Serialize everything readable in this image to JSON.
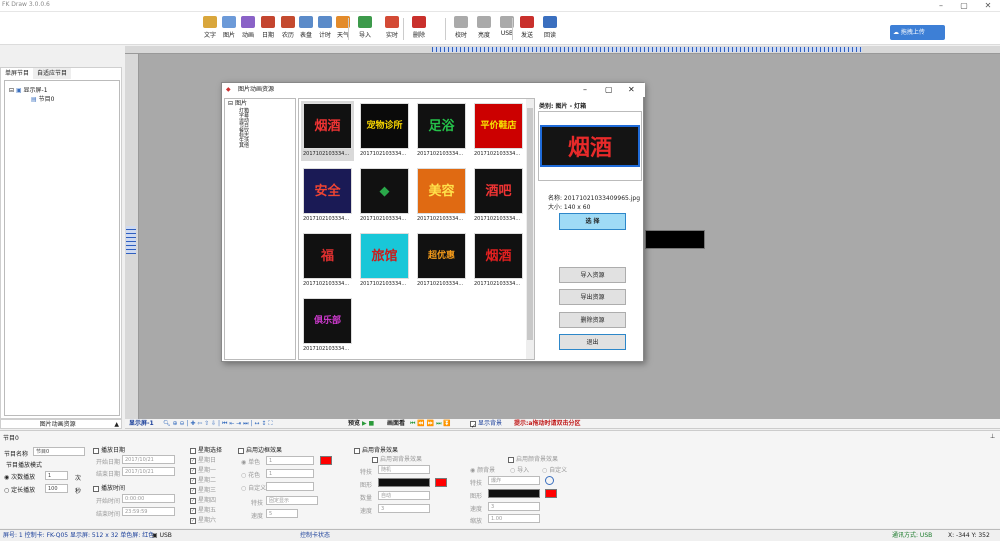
{
  "window": {
    "title": "FK Draw 3.0.0.6"
  },
  "toolbar": {
    "items": [
      {
        "label": "文字",
        "color": "#d9a63b"
      },
      {
        "label": "图片",
        "color": "#6c9ad8"
      },
      {
        "label": "动画",
        "color": "#8a62c7"
      },
      {
        "label": "日期",
        "color": "#c4452f"
      },
      {
        "label": "农历",
        "color": "#c44a2f"
      },
      {
        "label": "表盘",
        "color": "#5b8bc9"
      },
      {
        "label": "计时",
        "color": "#5b8bc9"
      },
      {
        "label": "天气",
        "color": "#e38b2b"
      },
      {
        "label": "导入",
        "color": "#3d9a4b"
      },
      {
        "label": "实时",
        "color": "#d34a35"
      },
      {
        "label": "删除",
        "color": "#c9302c"
      },
      {
        "label": "校时",
        "color": "#aaaaaa"
      },
      {
        "label": "亮度",
        "color": "#aaaaaa"
      },
      {
        "label": "USB",
        "color": "#aaaaaa"
      },
      {
        "label": "发送",
        "color": "#c9302c"
      },
      {
        "label": "回读",
        "color": "#3a6fbf"
      }
    ],
    "cloud_label": "拖拽上传"
  },
  "left_panel": {
    "tabs": [
      "单屏节目",
      "自适应节目"
    ],
    "tree_root": "显示屏-1",
    "tree_child": "节目0",
    "bottom_label": "图片动画资源"
  },
  "dialog": {
    "title": "图片动画资源",
    "tree_root": "图片",
    "categories": [
      "灯箱",
      "字幕",
      "运动",
      "节日",
      "餐饮",
      "标志",
      "生活",
      "其他"
    ],
    "thumbs": [
      {
        "caption": "2017102103334...",
        "text": "烟酒",
        "bg": "#111",
        "fg": "#e33"
      },
      {
        "caption": "2017102103334...",
        "text": "宠物诊所",
        "bg": "#0a0a0a",
        "fg": "#f5d300"
      },
      {
        "caption": "2017102103334...",
        "text": "足浴",
        "bg": "#111",
        "fg": "#25c24a"
      },
      {
        "caption": "2017102103334...",
        "text": "平价鞋店",
        "bg": "#c00",
        "fg": "#f7e400"
      },
      {
        "caption": "2017102103334...",
        "text": "安全",
        "bg": "#1a1a55",
        "fg": "#e43"
      },
      {
        "caption": "2017102103334...",
        "text": "◆",
        "bg": "#111",
        "fg": "#2aa84a"
      },
      {
        "caption": "2017102103334...",
        "text": "美容",
        "bg": "#e06a12",
        "fg": "#ffe14a"
      },
      {
        "caption": "2017102103334...",
        "text": "酒吧",
        "bg": "#111",
        "fg": "#e33"
      },
      {
        "caption": "2017102103334...",
        "text": "福",
        "bg": "#111",
        "fg": "#e03030"
      },
      {
        "caption": "2017102103334...",
        "text": "旅馆",
        "bg": "#19c7d8",
        "fg": "#c81d1d"
      },
      {
        "caption": "2017102103334...",
        "text": "超优惠",
        "bg": "#111",
        "fg": "#f39a1a"
      },
      {
        "caption": "2017102103334...",
        "text": "烟酒",
        "bg": "#111",
        "fg": "#e32020"
      },
      {
        "caption": "2017102103334...",
        "text": "俱乐部",
        "bg": "#111",
        "fg": "#d33bd3"
      }
    ],
    "category_label": "类别: 图片 - 灯箱",
    "preview_text": "烟酒",
    "name_label": "名称: 20171021033409965.jpg",
    "size_label": "大小: 140 x 60",
    "select_label": "选 择",
    "import_label": "导入资源",
    "export_label": "导出资源",
    "delete_label": "删除资源",
    "exit_label": "退出"
  },
  "ctrlbar": {
    "screen_label": "显示屏-1",
    "preview_label": "预览",
    "view_label": "画面看",
    "show_bg_label": "显示背景",
    "hint": "提示:a拖动时请双击分区"
  },
  "props": {
    "header": "节目0",
    "name_label": "节目名称",
    "name_value": "节目0",
    "mode_label": "节目播放模式",
    "times_label": "次数播放",
    "times_value": "1",
    "times_unit": "次",
    "fixed_label": "定长播放",
    "fixed_value": "100",
    "fixed_unit": "秒",
    "date_section": "播放日期",
    "start_date_label": "开始日期",
    "start_date": "2017/10/21",
    "end_date_label": "结束日期",
    "end_date": "2017/10/21",
    "time_section": "播放时间",
    "start_time_label": "开始时间",
    "start_time": "0:00:00",
    "end_time_label": "结束时间",
    "end_time": "23:59:59",
    "week_section": "星期选择",
    "weekdays": [
      "星期日",
      "星期一",
      "星期二",
      "星期三",
      "星期四",
      "星期五",
      "星期六"
    ],
    "border_section": "启用边框效果",
    "border_single": "单色",
    "border_color": "花色",
    "border_custom": "自定义",
    "border_value1": "1",
    "border_value2": "1",
    "border_effect_label": "特技",
    "border_effect": "固定显示",
    "border_speed_label": "速度",
    "border_speed": "5",
    "bg_section": "启用背景效果",
    "bg_sub1": "启用调背景效果",
    "bg_effect_label": "特技",
    "bg_effect": "随机",
    "bg_pattern_label": "图形",
    "bg_count_label": "数量",
    "bg_count": "自动",
    "bg_speed_label": "速度",
    "bg_speed": "3",
    "bg_sub2": "启用颜背景效果",
    "bg_radio1": "颜背景",
    "bg_radio2": "导入",
    "bg_radio3": "自定义",
    "bg2_effect_label": "特技",
    "bg2_effect": "爆炸",
    "bg2_pattern_label": "图形",
    "bg2_speed_label": "速度",
    "bg2_speed": "3",
    "bg2_scale_label": "缩放",
    "bg2_scale": "1.00"
  },
  "status": {
    "left": "屏号: 1 控制卡: FK-Q05 显示屏: 512 x 32 单色屏: 红色",
    "usb": "USB",
    "mid": "控制卡状态",
    "right": "通讯方式: USB",
    "coords": "X: -344  Y: 352"
  },
  "colors": {
    "accent": "#3d7fd6",
    "red": "#ff0000"
  }
}
